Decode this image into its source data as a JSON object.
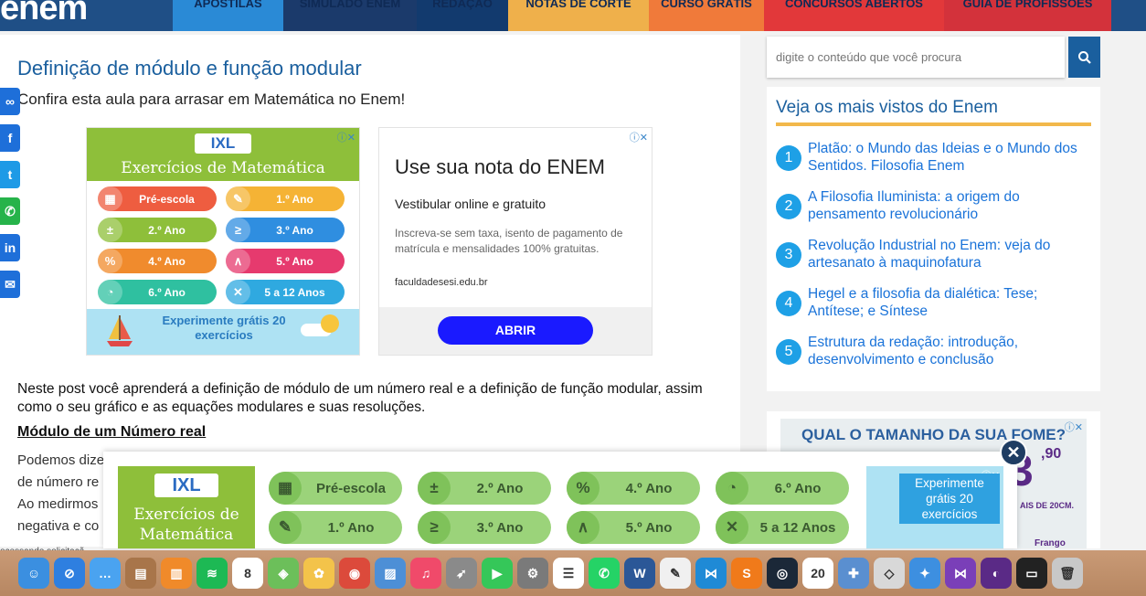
{
  "header": {
    "logo": "enem",
    "nav": [
      {
        "label": "APOSTILAS",
        "color": "#2a8ad6"
      },
      {
        "label": "SIMULADO ENEM",
        "color": "#1b3a6b"
      },
      {
        "label": "REDAÇÃO",
        "color": "#123a6e"
      },
      {
        "label": "NOTAS DE CORTE",
        "color": "#efb04b"
      },
      {
        "label": "CURSO GRÁTIS",
        "color": "#f07a3a"
      },
      {
        "label": "CONCURSOS ABERTOS",
        "color": "#e2383a"
      },
      {
        "label": "GUIA DE PROFISSÕES",
        "color": "#d3323b"
      }
    ]
  },
  "article": {
    "title": "Definição de módulo e função modular",
    "subtitle": "Confira esta aula para arrasar em Matemática no Enem!",
    "intro": "Neste post você aprenderá a definição de módulo de um número real e a definição de função modular, assim como o seu gráfico e as equações modulares e suas resoluções.",
    "section_heading": "Módulo de um Número real",
    "paragraph_lines": [
      "Podemos dize",
      "de número re",
      "Ao medirmos",
      "negativa e co"
    ]
  },
  "share": {
    "buttons": [
      {
        "icon": "link-icon",
        "glyph": "∞",
        "color": "#1e6fd9"
      },
      {
        "icon": "facebook-icon",
        "glyph": "f",
        "color": "#1e6fd9"
      },
      {
        "icon": "twitter-icon",
        "glyph": "t",
        "color": "#1e9ae6"
      },
      {
        "icon": "whatsapp-icon",
        "glyph": "✆",
        "color": "#26b34a"
      },
      {
        "icon": "linkedin-icon",
        "glyph": "in",
        "color": "#1e6fd9"
      },
      {
        "icon": "email-icon",
        "glyph": "✉",
        "color": "#1e6fd9"
      }
    ]
  },
  "ixl_ad": {
    "logo": "IXL",
    "title": "Exercícios de Matemática",
    "grades": [
      {
        "label": "Pré-escola",
        "color": "#ee5d40",
        "icon": "▦"
      },
      {
        "label": "1.º Ano",
        "color": "#f5b335",
        "icon": "✎"
      },
      {
        "label": "2.º Ano",
        "color": "#8ebf3a",
        "icon": "±"
      },
      {
        "label": "3.º Ano",
        "color": "#2f8ee0",
        "icon": "≥"
      },
      {
        "label": "4.º Ano",
        "color": "#f08b2d",
        "icon": "%"
      },
      {
        "label": "5.º Ano",
        "color": "#e63a6e",
        "icon": "∧"
      },
      {
        "label": "6.º Ano",
        "color": "#2fc0a0",
        "icon": "◔"
      },
      {
        "label": "5 a 12 Anos",
        "color": "#2fa9e0",
        "icon": "✕"
      }
    ],
    "footer": "Experimente grátis 20 exercícios"
  },
  "text_ad": {
    "title": "Use sua nota do ENEM",
    "subtitle": "Vestibular online e gratuito",
    "description": "Inscreva-se sem taxa, isento de pagamento de matrícula e mensalidades 100% gratuitas.",
    "url": "faculdadesesi.edu.br",
    "button": "ABRIR"
  },
  "sidebar": {
    "search_placeholder": "digite o conteúdo que você procura",
    "popular_title": "Veja os mais vistos do Enem",
    "popular": [
      {
        "num": "1",
        "text": "Platão: o Mundo das Ideias e o Mundo dos Sentidos. Filosofia Enem"
      },
      {
        "num": "2",
        "text": "A Filosofia Iluminista: a origem do pensamento revolucionário"
      },
      {
        "num": "3",
        "text": "Revolução Industrial no Enem: veja do artesanato à maquinofatura"
      },
      {
        "num": "4",
        "text": "Hegel e a filosofia da dialética: Tese; Antítese; e Síntese"
      },
      {
        "num": "5",
        "text": "Estrutura da redação: introdução, desenvolvimento e conclusão"
      }
    ],
    "promo_title": "QUAL O TAMANHO DA SUA FOME?",
    "promo_big": "3",
    "promo_price": ",90",
    "promo_small": "AIS DE 20CM.",
    "promo_brand": "Frango"
  },
  "float_ad": {
    "logo": "IXL",
    "title": "Exercícios de Matemática",
    "grades": [
      {
        "label": "Pré-escola",
        "icon": "▦"
      },
      {
        "label": "2.º Ano",
        "icon": "±"
      },
      {
        "label": "4.º Ano",
        "icon": "%"
      },
      {
        "label": "6.º Ano",
        "icon": "◔"
      },
      {
        "label": "1.º Ano",
        "icon": "✎"
      },
      {
        "label": "3.º Ano",
        "icon": "≥"
      },
      {
        "label": "5.º Ano",
        "icon": "∧"
      },
      {
        "label": "5 a 12 Anos",
        "icon": "✕"
      }
    ],
    "right_text": "Experimente grátis 20 exercícios",
    "close": "✕"
  },
  "status_text": "ocessando solicitaçã",
  "dock": {
    "apps": [
      {
        "name": "finder-icon",
        "color": "#3b8fe0",
        "glyph": "☺"
      },
      {
        "name": "safari-icon",
        "color": "#2e7fe0",
        "glyph": "⊘"
      },
      {
        "name": "messages-icon",
        "color": "#4aa3f0",
        "glyph": "…"
      },
      {
        "name": "contacts-icon",
        "color": "#a8754a",
        "glyph": "▤"
      },
      {
        "name": "books-icon",
        "color": "#f08a2a",
        "glyph": "▥"
      },
      {
        "name": "spotify-icon",
        "color": "#1db954",
        "glyph": "≋"
      },
      {
        "name": "calendar-icon",
        "color": "#ffffff",
        "glyph": "8"
      },
      {
        "name": "maps-icon",
        "color": "#6cbf5a",
        "glyph": "◈"
      },
      {
        "name": "photos-icon",
        "color": "#f3c34a",
        "glyph": "✿"
      },
      {
        "name": "chrome-icon",
        "color": "#dc4a3b",
        "glyph": "◉"
      },
      {
        "name": "preview-icon",
        "color": "#4d8fd6",
        "glyph": "▨"
      },
      {
        "name": "music-icon",
        "color": "#f04a6a",
        "glyph": "♫"
      },
      {
        "name": "launchpad-icon",
        "color": "#8a8a8a",
        "glyph": "➶"
      },
      {
        "name": "facetime-icon",
        "color": "#35c759",
        "glyph": "▶"
      },
      {
        "name": "system-preferences-icon",
        "color": "#7a7a7a",
        "glyph": "⚙"
      },
      {
        "name": "reminders-icon",
        "color": "#ffffff",
        "glyph": "☰"
      },
      {
        "name": "whatsapp-dock-icon",
        "color": "#25d366",
        "glyph": "✆"
      },
      {
        "name": "word-icon",
        "color": "#2b5797",
        "glyph": "W"
      },
      {
        "name": "textedit-icon",
        "color": "#f0f0f0",
        "glyph": "✎"
      },
      {
        "name": "vscode-icon",
        "color": "#1f8ad6",
        "glyph": "⋈"
      },
      {
        "name": "sublime-icon",
        "color": "#f07a1a",
        "glyph": "S"
      },
      {
        "name": "steam-icon",
        "color": "#1b2838",
        "glyph": "◎"
      },
      {
        "name": "app-20-icon",
        "color": "#ffffff",
        "glyph": "20"
      },
      {
        "name": "tableau-icon",
        "color": "#5a8fd0",
        "glyph": "✚"
      },
      {
        "name": "roblox-icon",
        "color": "#d8d8d8",
        "glyph": "◇"
      },
      {
        "name": "xcode-icon",
        "color": "#3d8fe0",
        "glyph": "✦"
      },
      {
        "name": "visual-studio-icon",
        "color": "#7a3fb8",
        "glyph": "⋈"
      },
      {
        "name": "tor-icon",
        "color": "#5a2a86",
        "glyph": "◐"
      },
      {
        "name": "terminal-icon",
        "color": "#222222",
        "glyph": "▭"
      },
      {
        "name": "trash-icon",
        "color": "#c8c8c8",
        "glyph": "🗑"
      }
    ]
  }
}
